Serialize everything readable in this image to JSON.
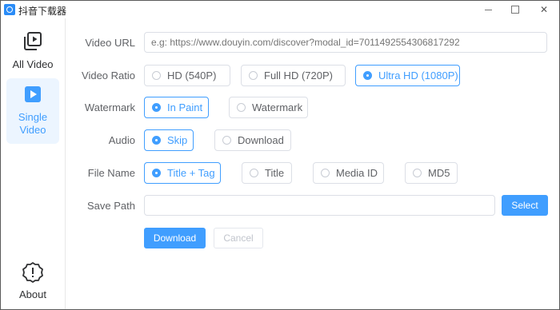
{
  "window": {
    "title": "抖音下载器",
    "close_glyph": "✕"
  },
  "sidebar": {
    "items": [
      {
        "label": "All Video",
        "icon": "video-library-icon",
        "active": false
      },
      {
        "label": "Single Video",
        "label_line1": "Single",
        "label_line2": "Video",
        "icon": "play-square-icon",
        "active": true
      },
      {
        "label": "About",
        "icon": "info-alert-icon",
        "active": false
      }
    ]
  },
  "form": {
    "video_url": {
      "label": "Video URL",
      "value": "",
      "placeholder": "e.g: https://www.douyin.com/discover?modal_id=7011492554306817292"
    },
    "video_ratio": {
      "label": "Video Ratio",
      "options": [
        "HD (540P)",
        "Full HD (720P)",
        "Ultra HD (1080P)"
      ],
      "selected": "Ultra HD (1080P)"
    },
    "watermark": {
      "label": "Watermark",
      "options": [
        "In Paint",
        "Watermark"
      ],
      "selected": "In Paint"
    },
    "audio": {
      "label": "Audio",
      "options": [
        "Skip",
        "Download"
      ],
      "selected": "Skip"
    },
    "file_name": {
      "label": "File Name",
      "options": [
        "Title + Tag",
        "Title",
        "Media ID",
        "MD5"
      ],
      "selected": "Title + Tag"
    },
    "save_path": {
      "label": "Save Path",
      "value": "",
      "select_button": "Select"
    },
    "download_button": "Download",
    "cancel_button": "Cancel"
  },
  "colors": {
    "accent": "#409eff",
    "sidebar_active_bg": "#ecf5ff",
    "border": "#dcdfe6",
    "text": "#606266"
  }
}
